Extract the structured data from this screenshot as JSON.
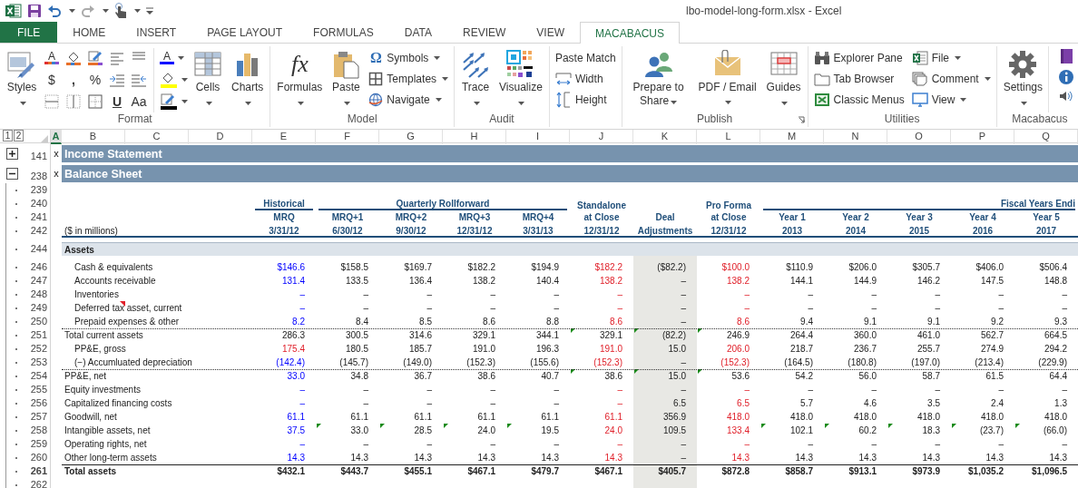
{
  "window": {
    "title": "lbo-model-long-form.xlsx - Excel"
  },
  "tabs": [
    {
      "label": "FILE",
      "kind": "file",
      "selected": false
    },
    {
      "label": "HOME",
      "kind": "tab",
      "selected": false
    },
    {
      "label": "INSERT",
      "kind": "tab",
      "selected": false
    },
    {
      "label": "PAGE LAYOUT",
      "kind": "tab",
      "selected": false
    },
    {
      "label": "FORMULAS",
      "kind": "tab",
      "selected": false
    },
    {
      "label": "DATA",
      "kind": "tab",
      "selected": false
    },
    {
      "label": "REVIEW",
      "kind": "tab",
      "selected": false
    },
    {
      "label": "VIEW",
      "kind": "tab",
      "selected": false
    },
    {
      "label": "MACABACUS",
      "kind": "tab",
      "selected": true
    }
  ],
  "ribbon": {
    "groups": [
      {
        "label": "Format",
        "glyphs": [
          "A",
          "$",
          ",",
          "%",
          "U",
          "Aa",
          "A"
        ],
        "items": [
          {
            "label": "Styles",
            "kind": "large",
            "dropdown": true
          },
          {
            "label": "Cells",
            "kind": "large",
            "dropdown": true
          },
          {
            "label": "Charts",
            "kind": "large",
            "dropdown": true
          }
        ]
      },
      {
        "label": "Model",
        "items": [
          {
            "label": "Formulas",
            "kind": "large",
            "dropdown": true,
            "glyph": "fx"
          },
          {
            "label": "Paste",
            "kind": "large",
            "dropdown": true
          },
          {
            "label": "Symbols",
            "kind": "small",
            "dropdown": true,
            "glyph": "Ω"
          },
          {
            "label": "Templates",
            "kind": "small",
            "dropdown": true
          },
          {
            "label": "Navigate",
            "kind": "small",
            "dropdown": true
          }
        ]
      },
      {
        "label": "Audit",
        "items": [
          {
            "label": "Trace",
            "kind": "large",
            "dropdown": true
          },
          {
            "label": "Visualize",
            "kind": "large",
            "dropdown": true
          }
        ]
      },
      {
        "items": [
          {
            "label": "Paste Match",
            "kind": "small",
            "dropdown": false
          },
          {
            "label": "Width",
            "kind": "small",
            "dropdown": false
          },
          {
            "label": "Height",
            "kind": "small",
            "dropdown": false
          }
        ]
      },
      {
        "label": "Publish",
        "launcher": true,
        "items": [
          {
            "label": "Prepare to Share",
            "kind": "large",
            "dropdown": true
          },
          {
            "label": "PDF / Email",
            "kind": "large",
            "dropdown": true
          },
          {
            "label": "Guides",
            "kind": "large",
            "dropdown": true
          }
        ]
      },
      {
        "label": "Utilities",
        "items": [
          {
            "label": "Explorer Pane",
            "kind": "small",
            "dropdown": false
          },
          {
            "label": "Tab Browser",
            "kind": "small",
            "dropdown": false
          },
          {
            "label": "Classic Menus",
            "kind": "small",
            "dropdown": false
          },
          {
            "label": "File",
            "kind": "small",
            "dropdown": true
          },
          {
            "label": "Comment",
            "kind": "small",
            "dropdown": true
          },
          {
            "label": "View",
            "kind": "small",
            "dropdown": true
          }
        ]
      },
      {
        "label": "Macabacus",
        "items": [
          {
            "label": "Settings",
            "kind": "large",
            "dropdown": true
          }
        ]
      }
    ]
  },
  "sheet": {
    "outline_levels": [
      "1",
      "2"
    ],
    "columns": [
      {
        "letter": "A",
        "selected": true
      },
      {
        "letter": "B",
        "selected": false
      },
      {
        "letter": "C",
        "selected": false
      },
      {
        "letter": "D",
        "selected": false
      },
      {
        "letter": "E",
        "selected": false
      },
      {
        "letter": "F",
        "selected": false
      },
      {
        "letter": "G",
        "selected": false
      },
      {
        "letter": "H",
        "selected": false
      },
      {
        "letter": "I",
        "selected": false
      },
      {
        "letter": "J",
        "selected": false
      },
      {
        "letter": "K",
        "selected": false,
        "shaded": true
      },
      {
        "letter": "L",
        "selected": false
      },
      {
        "letter": "M",
        "selected": false
      },
      {
        "letter": "N",
        "selected": false
      },
      {
        "letter": "O",
        "selected": false
      },
      {
        "letter": "P",
        "selected": false
      },
      {
        "letter": "Q",
        "selected": false
      }
    ],
    "rows": [
      {
        "num": "141",
        "kind": "section",
        "marker": "x",
        "title": "Income Statement",
        "expanded": false
      },
      {
        "num": "238",
        "kind": "section",
        "marker": "x",
        "title": "Balance Sheet",
        "expanded": true
      },
      {
        "num": "239",
        "kind": "blank"
      },
      {
        "num": "240",
        "kind": "groups",
        "cells": {
          "E": {
            "text": "Historical",
            "underline": true
          },
          "F": {
            "text": "Quarterly Rollforward",
            "underline": true
          },
          "J": {
            "text": "Standalone",
            "underline": false
          },
          "L": {
            "text": "Pro Forma",
            "underline": false
          },
          "M": {
            "text": "Fiscal Years Endi",
            "underline": true
          }
        }
      },
      {
        "num": "241",
        "kind": "header",
        "cells": {
          "E": "MRQ",
          "F": "MRQ+1",
          "G": "MRQ+2",
          "H": "MRQ+3",
          "I": "MRQ+4",
          "J": "at Close",
          "K": "Deal",
          "L": "at Close",
          "M": "Year 1",
          "N": "Year 2",
          "O": "Year 3",
          "P": "Year 4",
          "Q": "Year 5"
        }
      },
      {
        "num": "242",
        "kind": "header",
        "rule_below": true,
        "cells": {
          "B": "($ in millions)",
          "E": "3/31/12",
          "F": "6/30/12",
          "G": "9/30/12",
          "H": "12/31/12",
          "I": "3/31/13",
          "J": "12/31/12",
          "K": "Adjustments",
          "L": "12/31/12",
          "M": "2013",
          "N": "2014",
          "O": "2015",
          "P": "2016",
          "Q": "2017"
        }
      },
      {
        "kind": "gap"
      },
      {
        "num": "244",
        "kind": "band",
        "label": "Assets"
      },
      {
        "kind": "gap"
      },
      {
        "num": "246",
        "kind": "detail",
        "label": "Cash & equivalents",
        "values": [
          {
            "text": "$146.6",
            "kind": "input"
          },
          {
            "text": "$158.5",
            "kind": "formula"
          },
          {
            "text": "$169.7",
            "kind": "formula"
          },
          {
            "text": "$182.2",
            "kind": "formula"
          },
          {
            "text": "$194.9",
            "kind": "formula"
          },
          {
            "text": "$182.2",
            "kind": "link"
          },
          {
            "text": "($82.2)",
            "kind": "formula"
          },
          {
            "text": "$100.0",
            "kind": "link"
          },
          {
            "text": "$110.9",
            "kind": "formula"
          },
          {
            "text": "$206.0",
            "kind": "formula"
          },
          {
            "text": "$305.7",
            "kind": "formula"
          },
          {
            "text": "$406.0",
            "kind": "formula"
          },
          {
            "text": "$506.4",
            "kind": "formula"
          }
        ]
      },
      {
        "num": "247",
        "kind": "detail",
        "label": "Accounts receivable",
        "values": [
          {
            "text": "131.4",
            "kind": "input"
          },
          {
            "text": "133.5",
            "kind": "formula"
          },
          {
            "text": "136.4",
            "kind": "formula"
          },
          {
            "text": "138.2",
            "kind": "formula"
          },
          {
            "text": "140.4",
            "kind": "formula"
          },
          {
            "text": "138.2",
            "kind": "link"
          },
          {
            "text": "–",
            "kind": "formula"
          },
          {
            "text": "138.2",
            "kind": "link"
          },
          {
            "text": "144.1",
            "kind": "formula"
          },
          {
            "text": "144.9",
            "kind": "formula"
          },
          {
            "text": "146.2",
            "kind": "formula"
          },
          {
            "text": "147.5",
            "kind": "formula"
          },
          {
            "text": "148.8",
            "kind": "formula"
          }
        ]
      },
      {
        "num": "248",
        "kind": "detail",
        "label": "Inventories",
        "values": [
          {
            "text": "–",
            "kind": "input"
          },
          {
            "text": "–",
            "kind": "formula"
          },
          {
            "text": "–",
            "kind": "formula"
          },
          {
            "text": "–",
            "kind": "formula"
          },
          {
            "text": "–",
            "kind": "formula"
          },
          {
            "text": "–",
            "kind": "link"
          },
          {
            "text": "–",
            "kind": "formula"
          },
          {
            "text": "–",
            "kind": "link"
          },
          {
            "text": "–",
            "kind": "formula"
          },
          {
            "text": "–",
            "kind": "formula"
          },
          {
            "text": "–",
            "kind": "formula"
          },
          {
            "text": "–",
            "kind": "formula"
          },
          {
            "text": "–",
            "kind": "formula"
          }
        ]
      },
      {
        "num": "249",
        "kind": "detail",
        "label": "Deferred tax asset, current",
        "comment": true,
        "values": [
          {
            "text": "–",
            "kind": "input"
          },
          {
            "text": "–",
            "kind": "formula"
          },
          {
            "text": "–",
            "kind": "formula"
          },
          {
            "text": "–",
            "kind": "formula"
          },
          {
            "text": "–",
            "kind": "formula"
          },
          {
            "text": "–",
            "kind": "link"
          },
          {
            "text": "–",
            "kind": "formula"
          },
          {
            "text": "–",
            "kind": "link"
          },
          {
            "text": "–",
            "kind": "formula"
          },
          {
            "text": "–",
            "kind": "formula"
          },
          {
            "text": "–",
            "kind": "formula"
          },
          {
            "text": "–",
            "kind": "formula"
          },
          {
            "text": "–",
            "kind": "formula"
          }
        ]
      },
      {
        "num": "250",
        "kind": "detail",
        "label": "Prepaid expenses & other",
        "values": [
          {
            "text": "8.2",
            "kind": "input"
          },
          {
            "text": "8.4",
            "kind": "formula"
          },
          {
            "text": "8.5",
            "kind": "formula"
          },
          {
            "text": "8.6",
            "kind": "formula"
          },
          {
            "text": "8.8",
            "kind": "formula"
          },
          {
            "text": "8.6",
            "kind": "link"
          },
          {
            "text": "–",
            "kind": "formula"
          },
          {
            "text": "8.6",
            "kind": "link"
          },
          {
            "text": "9.4",
            "kind": "formula"
          },
          {
            "text": "9.1",
            "kind": "formula"
          },
          {
            "text": "9.1",
            "kind": "formula"
          },
          {
            "text": "9.2",
            "kind": "formula"
          },
          {
            "text": "9.3",
            "kind": "formula"
          }
        ]
      },
      {
        "num": "251",
        "kind": "line",
        "dotted_rule_above": true,
        "label": "Total current assets",
        "values": [
          {
            "text": "286.3",
            "kind": "formula"
          },
          {
            "text": "300.5",
            "kind": "formula"
          },
          {
            "text": "314.6",
            "kind": "formula"
          },
          {
            "text": "329.1",
            "kind": "formula"
          },
          {
            "text": "344.1",
            "kind": "formula"
          },
          {
            "text": "329.1",
            "kind": "formula",
            "flag": true
          },
          {
            "text": "(82.2)",
            "kind": "formula",
            "flag": true
          },
          {
            "text": "246.9",
            "kind": "formula",
            "flag": true
          },
          {
            "text": "264.4",
            "kind": "formula"
          },
          {
            "text": "360.0",
            "kind": "formula"
          },
          {
            "text": "461.0",
            "kind": "formula"
          },
          {
            "text": "562.7",
            "kind": "formula"
          },
          {
            "text": "664.5",
            "kind": "formula"
          }
        ]
      },
      {
        "num": "252",
        "kind": "detail",
        "label": "PP&E, gross",
        "values": [
          {
            "text": "175.4",
            "kind": "link"
          },
          {
            "text": "180.5",
            "kind": "formula"
          },
          {
            "text": "185.7",
            "kind": "formula"
          },
          {
            "text": "191.0",
            "kind": "formula"
          },
          {
            "text": "196.3",
            "kind": "formula"
          },
          {
            "text": "191.0",
            "kind": "link"
          },
          {
            "text": "15.0",
            "kind": "formula"
          },
          {
            "text": "206.0",
            "kind": "link"
          },
          {
            "text": "218.7",
            "kind": "formula"
          },
          {
            "text": "236.7",
            "kind": "formula"
          },
          {
            "text": "255.7",
            "kind": "formula"
          },
          {
            "text": "274.9",
            "kind": "formula"
          },
          {
            "text": "294.2",
            "kind": "formula"
          }
        ]
      },
      {
        "num": "253",
        "kind": "detail",
        "label": "(−) Accumluated depreciation",
        "values": [
          {
            "text": "(142.4)",
            "kind": "input"
          },
          {
            "text": "(145.7)",
            "kind": "formula"
          },
          {
            "text": "(149.0)",
            "kind": "formula"
          },
          {
            "text": "(152.3)",
            "kind": "formula"
          },
          {
            "text": "(155.6)",
            "kind": "formula"
          },
          {
            "text": "(152.3)",
            "kind": "link"
          },
          {
            "text": "–",
            "kind": "formula"
          },
          {
            "text": "(152.3)",
            "kind": "link"
          },
          {
            "text": "(164.5)",
            "kind": "formula"
          },
          {
            "text": "(180.8)",
            "kind": "formula"
          },
          {
            "text": "(197.0)",
            "kind": "formula"
          },
          {
            "text": "(213.4)",
            "kind": "formula"
          },
          {
            "text": "(229.9)",
            "kind": "formula"
          }
        ]
      },
      {
        "num": "254",
        "kind": "line",
        "dotted_rule_above": true,
        "label": "PP&E, net",
        "values": [
          {
            "text": "33.0",
            "kind": "input"
          },
          {
            "text": "34.8",
            "kind": "formula"
          },
          {
            "text": "36.7",
            "kind": "formula"
          },
          {
            "text": "38.6",
            "kind": "formula"
          },
          {
            "text": "40.7",
            "kind": "formula"
          },
          {
            "text": "38.6",
            "kind": "formula",
            "flag": true
          },
          {
            "text": "15.0",
            "kind": "formula",
            "flag": true
          },
          {
            "text": "53.6",
            "kind": "formula",
            "flag": true
          },
          {
            "text": "54.2",
            "kind": "formula"
          },
          {
            "text": "56.0",
            "kind": "formula"
          },
          {
            "text": "58.7",
            "kind": "formula"
          },
          {
            "text": "61.5",
            "kind": "formula"
          },
          {
            "text": "64.4",
            "kind": "formula"
          }
        ]
      },
      {
        "num": "255",
        "kind": "line",
        "label": "Equity investments",
        "values": [
          {
            "text": "–",
            "kind": "input"
          },
          {
            "text": "–",
            "kind": "formula"
          },
          {
            "text": "–",
            "kind": "formula"
          },
          {
            "text": "–",
            "kind": "formula"
          },
          {
            "text": "–",
            "kind": "formula"
          },
          {
            "text": "–",
            "kind": "link"
          },
          {
            "text": "–",
            "kind": "formula"
          },
          {
            "text": "–",
            "kind": "link"
          },
          {
            "text": "–",
            "kind": "formula"
          },
          {
            "text": "–",
            "kind": "formula"
          },
          {
            "text": "–",
            "kind": "formula"
          },
          {
            "text": "–",
            "kind": "formula"
          },
          {
            "text": "–",
            "kind": "formula"
          }
        ]
      },
      {
        "num": "256",
        "kind": "line",
        "label": "Capitalized financing costs",
        "values": [
          {
            "text": "–",
            "kind": "input"
          },
          {
            "text": "–",
            "kind": "formula"
          },
          {
            "text": "–",
            "kind": "formula"
          },
          {
            "text": "–",
            "kind": "formula"
          },
          {
            "text": "–",
            "kind": "formula"
          },
          {
            "text": "–",
            "kind": "link"
          },
          {
            "text": "6.5",
            "kind": "formula"
          },
          {
            "text": "6.5",
            "kind": "link"
          },
          {
            "text": "5.7",
            "kind": "formula"
          },
          {
            "text": "4.6",
            "kind": "formula"
          },
          {
            "text": "3.5",
            "kind": "formula"
          },
          {
            "text": "2.4",
            "kind": "formula"
          },
          {
            "text": "1.3",
            "kind": "formula"
          }
        ]
      },
      {
        "num": "257",
        "kind": "line",
        "label": "Goodwill, net",
        "values": [
          {
            "text": "61.1",
            "kind": "input"
          },
          {
            "text": "61.1",
            "kind": "formula"
          },
          {
            "text": "61.1",
            "kind": "formula"
          },
          {
            "text": "61.1",
            "kind": "formula"
          },
          {
            "text": "61.1",
            "kind": "formula"
          },
          {
            "text": "61.1",
            "kind": "link"
          },
          {
            "text": "356.9",
            "kind": "formula"
          },
          {
            "text": "418.0",
            "kind": "link"
          },
          {
            "text": "418.0",
            "kind": "formula"
          },
          {
            "text": "418.0",
            "kind": "formula"
          },
          {
            "text": "418.0",
            "kind": "formula"
          },
          {
            "text": "418.0",
            "kind": "formula"
          },
          {
            "text": "418.0",
            "kind": "formula"
          }
        ]
      },
      {
        "num": "258",
        "kind": "line",
        "label": "Intangible assets, net",
        "values": [
          {
            "text": "37.5",
            "kind": "input"
          },
          {
            "text": "33.0",
            "kind": "formula",
            "flag": true
          },
          {
            "text": "28.5",
            "kind": "formula",
            "flag": true
          },
          {
            "text": "24.0",
            "kind": "formula",
            "flag": true
          },
          {
            "text": "19.5",
            "kind": "formula",
            "flag": true
          },
          {
            "text": "24.0",
            "kind": "link"
          },
          {
            "text": "109.5",
            "kind": "formula"
          },
          {
            "text": "133.4",
            "kind": "link"
          },
          {
            "text": "102.1",
            "kind": "formula",
            "flag": true
          },
          {
            "text": "60.2",
            "kind": "formula",
            "flag": true
          },
          {
            "text": "18.3",
            "kind": "formula",
            "flag": true
          },
          {
            "text": "(23.7)",
            "kind": "formula",
            "flag": true
          },
          {
            "text": "(66.0)",
            "kind": "formula",
            "flag": true
          }
        ]
      },
      {
        "num": "259",
        "kind": "line",
        "label": "Operating rights, net",
        "values": [
          {
            "text": "–",
            "kind": "input"
          },
          {
            "text": "–",
            "kind": "formula"
          },
          {
            "text": "–",
            "kind": "formula"
          },
          {
            "text": "–",
            "kind": "formula"
          },
          {
            "text": "–",
            "kind": "formula"
          },
          {
            "text": "–",
            "kind": "link"
          },
          {
            "text": "–",
            "kind": "formula"
          },
          {
            "text": "–",
            "kind": "link"
          },
          {
            "text": "–",
            "kind": "formula"
          },
          {
            "text": "–",
            "kind": "formula"
          },
          {
            "text": "–",
            "kind": "formula"
          },
          {
            "text": "–",
            "kind": "formula"
          },
          {
            "text": "–",
            "kind": "formula"
          }
        ]
      },
      {
        "num": "260",
        "kind": "line",
        "label": "Other long-term assets",
        "values": [
          {
            "text": "14.3",
            "kind": "input"
          },
          {
            "text": "14.3",
            "kind": "formula"
          },
          {
            "text": "14.3",
            "kind": "formula"
          },
          {
            "text": "14.3",
            "kind": "formula"
          },
          {
            "text": "14.3",
            "kind": "formula"
          },
          {
            "text": "14.3",
            "kind": "link"
          },
          {
            "text": "–",
            "kind": "formula"
          },
          {
            "text": "14.3",
            "kind": "link"
          },
          {
            "text": "14.3",
            "kind": "formula"
          },
          {
            "text": "14.3",
            "kind": "formula"
          },
          {
            "text": "14.3",
            "kind": "formula"
          },
          {
            "text": "14.3",
            "kind": "formula"
          },
          {
            "text": "14.3",
            "kind": "formula"
          }
        ]
      },
      {
        "num": "261",
        "kind": "total",
        "solid_rule_above": true,
        "label": "Total assets",
        "values": [
          {
            "text": "$432.1",
            "kind": "formula"
          },
          {
            "text": "$443.7",
            "kind": "formula"
          },
          {
            "text": "$455.1",
            "kind": "formula"
          },
          {
            "text": "$467.1",
            "kind": "formula"
          },
          {
            "text": "$479.7",
            "kind": "formula"
          },
          {
            "text": "$467.1",
            "kind": "formula"
          },
          {
            "text": "$405.7",
            "kind": "formula"
          },
          {
            "text": "$872.8",
            "kind": "formula"
          },
          {
            "text": "$858.7",
            "kind": "formula"
          },
          {
            "text": "$913.1",
            "kind": "formula"
          },
          {
            "text": "$973.9",
            "kind": "formula"
          },
          {
            "text": "$1,035.2",
            "kind": "formula"
          },
          {
            "text": "$1,096.5",
            "kind": "formula"
          }
        ]
      },
      {
        "num": "262",
        "kind": "blank"
      }
    ]
  }
}
